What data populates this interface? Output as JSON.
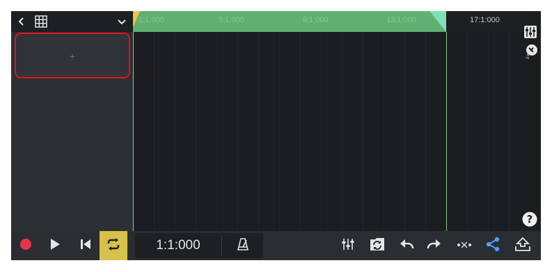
{
  "colors": {
    "accent_loop": "#d8c14a",
    "loop_region": "#62b071",
    "record": "#e8344a",
    "share": "#4aa3ff",
    "highlight": "#e0141b"
  },
  "icons": {
    "back": "chevron-left-icon",
    "grid": "grid-icon",
    "chevron": "chevron-down-icon",
    "mixer": "mixer-icon",
    "instrument": "instrument-icon",
    "help": "help-icon",
    "record": "record-icon",
    "play": "play-icon",
    "rewind": "skip-to-start-icon",
    "loop": "loop-icon",
    "metronome": "metronome-icon",
    "sync": "sync-icon",
    "undo": "undo-icon",
    "redo": "redo-icon",
    "more": "more-icon",
    "share": "share-icon",
    "export": "export-icon"
  },
  "track_panel": {
    "add_track_label": "+"
  },
  "ruler": {
    "labels": [
      "1:1:000",
      "5:1:000",
      "9:1:000",
      "13:1:000",
      "17:1:000"
    ]
  },
  "transport": {
    "time": "1:1:000"
  }
}
